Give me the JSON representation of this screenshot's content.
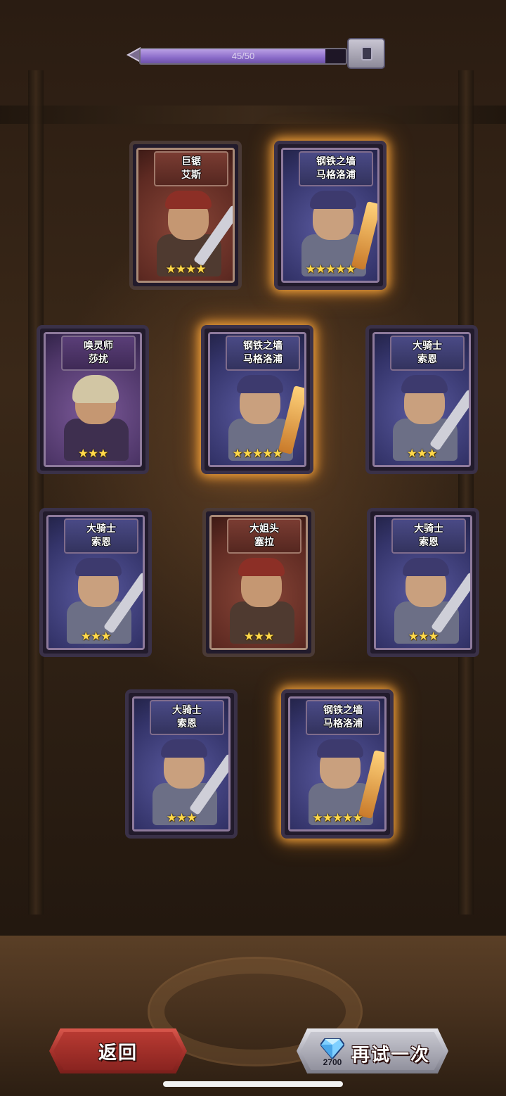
{
  "progress": {
    "text": "45/50",
    "value": 45,
    "max": 50,
    "fraction": 0.9
  },
  "cards": [
    {
      "title1": "巨锯",
      "title2": "艾斯",
      "stars": "★★★★",
      "frame": "red",
      "glow": false
    },
    {
      "title1": "钢铁之墙",
      "title2": "马格洛浦",
      "stars": "★★★★★",
      "frame": "violet",
      "glow": true
    },
    {
      "title1": "唤灵师",
      "title2": "莎扰",
      "stars": "★★★",
      "frame": "purple",
      "glow": false
    },
    {
      "title1": "钢铁之墙",
      "title2": "马格洛浦",
      "stars": "★★★★★",
      "frame": "violet",
      "glow": true
    },
    {
      "title1": "大骑士",
      "title2": "索恩",
      "stars": "★★★",
      "frame": "violet",
      "glow": false
    },
    {
      "title1": "大骑士",
      "title2": "索恩",
      "stars": "★★★",
      "frame": "violet",
      "glow": false
    },
    {
      "title1": "大姐头",
      "title2": "塞拉",
      "stars": "★★★",
      "frame": "red",
      "glow": false
    },
    {
      "title1": "大骑士",
      "title2": "索恩",
      "stars": "★★★",
      "frame": "violet",
      "glow": false
    },
    {
      "title1": "大骑士",
      "title2": "索恩",
      "stars": "★★★",
      "frame": "violet",
      "glow": false
    },
    {
      "title1": "钢铁之墙",
      "title2": "马格洛浦",
      "stars": "★★★★★",
      "frame": "violet",
      "glow": true
    }
  ],
  "buttons": {
    "back_label": "返回",
    "retry_label": "再试一次",
    "retry_cost": "2700",
    "cost_icon": "diamond-icon"
  },
  "colors": {
    "progress_fill": "#8a6bc9",
    "back_button": "#a3302a",
    "retry_button": "#a9a9b4",
    "gold_glow": "#ffaa3c",
    "star": "#ffd84a"
  }
}
